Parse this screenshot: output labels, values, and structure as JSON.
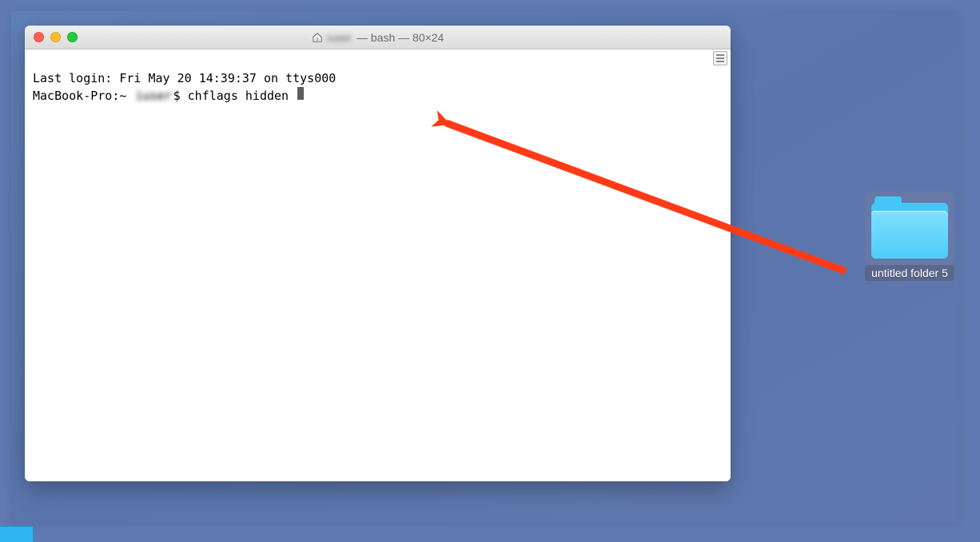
{
  "desktop": {
    "folder_label": "untitled folder 5"
  },
  "terminal": {
    "title_user_blurred": "iuser",
    "title_suffix": " — bash — 80×24",
    "line1": "Last login: Fri May 20 14:39:37 on ttys000",
    "prompt_prefix": "MacBook-Pro:~ ",
    "prompt_user_blurred": "iuser",
    "prompt_suffix": "$ ",
    "command": "chflags hidden "
  },
  "traffic": {
    "close": "close",
    "minimize": "minimize",
    "zoom": "zoom"
  }
}
